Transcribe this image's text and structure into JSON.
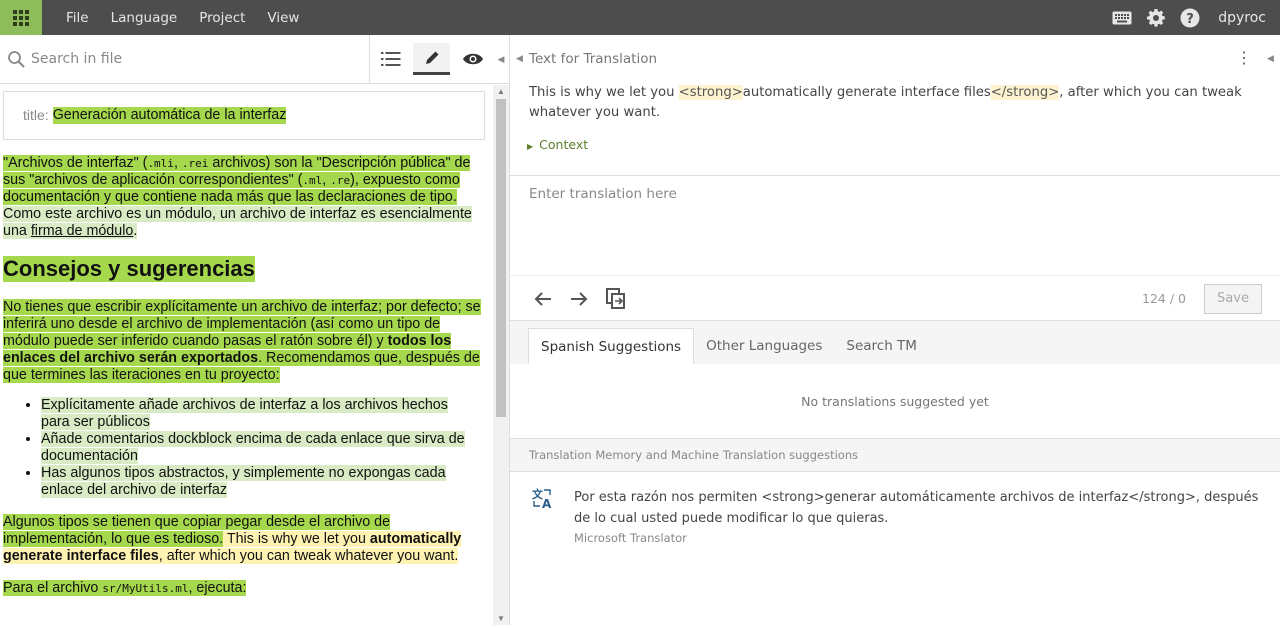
{
  "topbar": {
    "menu": [
      "File",
      "Language",
      "Project",
      "View"
    ],
    "user": "dpyroc"
  },
  "left": {
    "search_placeholder": "Search in file",
    "doc": {
      "title_label": "title:",
      "title_value": "Generación automática de la interfaz",
      "p1": {
        "a": "\"Archivos de interfaz\" (",
        "code1": ".mli",
        "b": ", ",
        "code2": ".rei",
        "c": " archivos) son la \"Descripción pública\" de sus \"archivos de aplicación correspondientes\" (",
        "code3": ".ml",
        "d": ", ",
        "code4": ".re",
        "e": "), expuesto como documentación y que contiene nada más que las declaraciones de tipo.",
        "f": " Como este archivo es un módulo, un archivo de interfaz es esencialmente una ",
        "link": "firma de módulo",
        "g": "."
      },
      "heading": "Consejos y sugerencias",
      "p2": {
        "a": "No tienes que escribir explícitamente un archivo de interfaz; por defecto; se inferirá uno desde el archivo de implementación (así como un tipo de módulo puede ser inferido cuando pasas el ratón sobre él) y ",
        "bold": "todos los enlaces del archivo serán exportados",
        "b": ". Recomendamos que, después de que termines las iteraciones en tu proyecto:"
      },
      "bullets": [
        "Explícitamente añade archivos de interfaz a los archivos hechos para ser públicos",
        "Añade comentarios dockblock encima de cada enlace que sirva de documentación",
        "Has algunos tipos abstractos, y simplemente no expongas cada enlace del archivo de interfaz"
      ],
      "p3": {
        "a": "Algunos tipos se tienen que copiar pegar desde el archivo de implementación, lo que es tedioso.",
        "b": " This is why we let you ",
        "bold": "automatically generate interface files",
        "c": ", after which you can tweak whatever you want."
      },
      "p4": {
        "a": "Para el archivo ",
        "code": "sr/MyUtils.ml",
        "b": ", ejecuta:"
      }
    }
  },
  "right": {
    "source_title": "Text for Translation",
    "source": {
      "a": "This is why we let you ",
      "tag_open": "<strong>",
      "b": "automatically generate interface files",
      "tag_close": "</strong>",
      "c": ", after which you can tweak whatever you want."
    },
    "context_label": "Context",
    "translation_placeholder": "Enter translation here",
    "counter": "124 / 0",
    "save_label": "Save",
    "tabs": [
      "Spanish Suggestions",
      "Other Languages",
      "Search TM"
    ],
    "no_suggestions": "No translations suggested yet",
    "tm_heading": "Translation Memory and Machine Translation suggestions",
    "tm_suggestion": {
      "text": "Por esta razón nos permiten <strong>generar automáticamente archivos de interfaz</strong>, después de lo cual usted puede modificar lo que quieras.",
      "source": "Microsoft Translator"
    }
  }
}
